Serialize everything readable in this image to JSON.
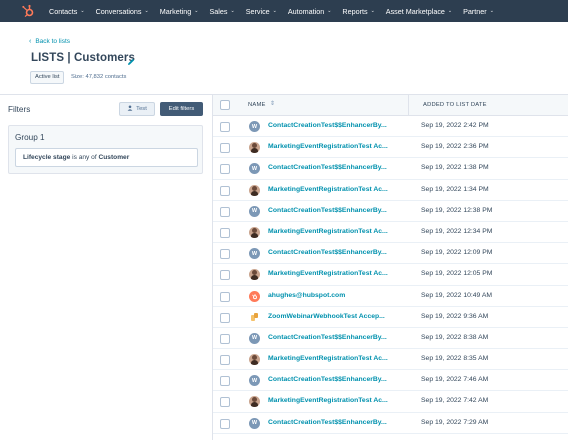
{
  "nav": {
    "items": [
      {
        "label": "Contacts"
      },
      {
        "label": "Conversations"
      },
      {
        "label": "Marketing"
      },
      {
        "label": "Sales"
      },
      {
        "label": "Service"
      },
      {
        "label": "Automation"
      },
      {
        "label": "Reports"
      },
      {
        "label": "Asset Marketplace"
      },
      {
        "label": "Partner"
      }
    ],
    "chevron": "⌄",
    "logo_icon": "hubspot-sprocket-icon",
    "bg_color": "#2d3e50"
  },
  "header": {
    "back_label": "Back to lists",
    "title": "LISTS | Customers",
    "badge": "Active list",
    "size_text": "Size: 47,832 contacts"
  },
  "filters": {
    "label": "Filters",
    "test_button": "Test",
    "edit_button": "Edit filters",
    "group_title": "Group 1",
    "rule": {
      "field": "Lifecycle stage",
      "operator": " is any of ",
      "value": "Customer"
    }
  },
  "table": {
    "columns": [
      "NAME",
      "ADDED TO LIST DATE"
    ],
    "rows": [
      {
        "name": "ContactCreationTest$$EnhancerBy...",
        "date": "Sep 19, 2022 2:42 PM",
        "avatar": "W"
      },
      {
        "name": "MarketingEventRegistrationTest Ac...",
        "date": "Sep 19, 2022 2:36 PM",
        "avatar": "photo"
      },
      {
        "name": "ContactCreationTest$$EnhancerBy...",
        "date": "Sep 19, 2022 1:38 PM",
        "avatar": "W"
      },
      {
        "name": "MarketingEventRegistrationTest Ac...",
        "date": "Sep 19, 2022 1:34 PM",
        "avatar": "photo"
      },
      {
        "name": "ContactCreationTest$$EnhancerBy...",
        "date": "Sep 19, 2022 12:38 PM",
        "avatar": "W"
      },
      {
        "name": "MarketingEventRegistrationTest Ac...",
        "date": "Sep 19, 2022 12:34 PM",
        "avatar": "photo"
      },
      {
        "name": "ContactCreationTest$$EnhancerBy...",
        "date": "Sep 19, 2022 12:09 PM",
        "avatar": "W"
      },
      {
        "name": "MarketingEventRegistrationTest Ac...",
        "date": "Sep 19, 2022 12:05 PM",
        "avatar": "photo"
      },
      {
        "name": "ahughes@hubspot.com",
        "date": "Sep 19, 2022 10:49 AM",
        "avatar": "hubspot"
      },
      {
        "name": "ZoomWebinarWebhookTest Accep...",
        "date": "Sep 19, 2022 9:36 AM",
        "avatar": "zoom"
      },
      {
        "name": "ContactCreationTest$$EnhancerBy...",
        "date": "Sep 19, 2022 8:38 AM",
        "avatar": "W"
      },
      {
        "name": "MarketingEventRegistrationTest Ac...",
        "date": "Sep 19, 2022 8:35 AM",
        "avatar": "photo"
      },
      {
        "name": "ContactCreationTest$$EnhancerBy...",
        "date": "Sep 19, 2022 7:46 AM",
        "avatar": "W"
      },
      {
        "name": "MarketingEventRegistrationTest Ac...",
        "date": "Sep 19, 2022 7:42 AM",
        "avatar": "photo"
      },
      {
        "name": "ContactCreationTest$$EnhancerBy...",
        "date": "Sep 19, 2022 7:29 AM",
        "avatar": "W"
      }
    ]
  },
  "colors": {
    "link": "#0091ae",
    "text": "#33475b",
    "accent_orange": "#ff7a59",
    "button_dark": "#425b76"
  }
}
